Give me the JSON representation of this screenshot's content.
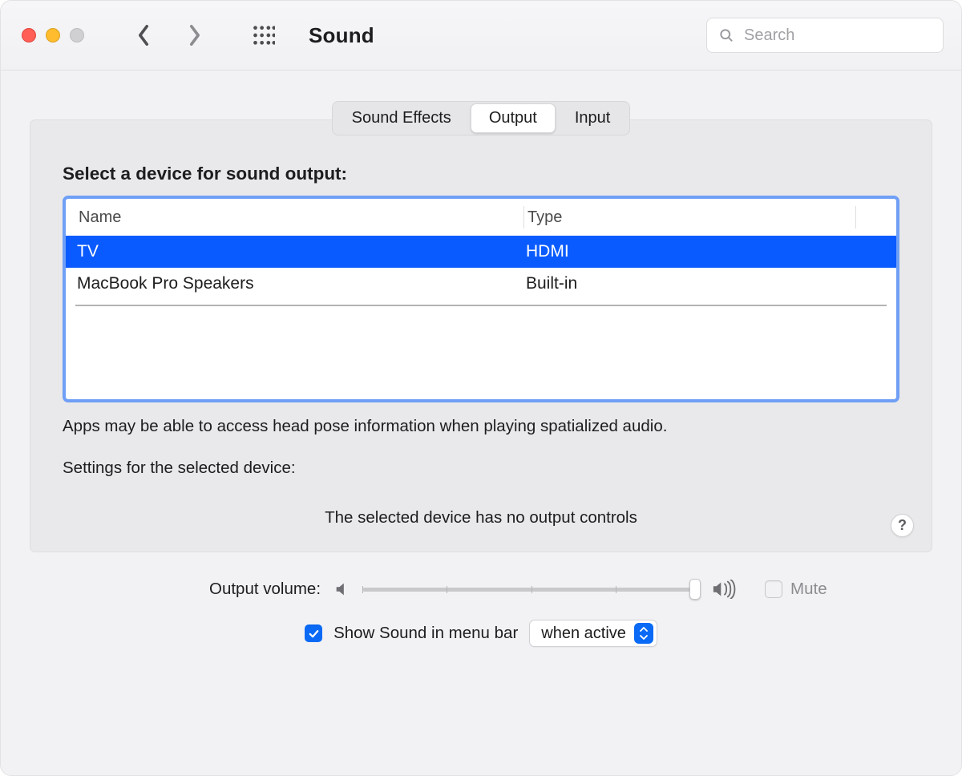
{
  "header": {
    "title": "Sound",
    "search_placeholder": "Search"
  },
  "tabs": [
    {
      "label": "Sound Effects",
      "selected": false
    },
    {
      "label": "Output",
      "selected": true
    },
    {
      "label": "Input",
      "selected": false
    }
  ],
  "main": {
    "section_label": "Select a device for sound output:",
    "columns": {
      "name": "Name",
      "type": "Type"
    },
    "devices": [
      {
        "name": "TV",
        "type": "HDMI",
        "selected": true
      },
      {
        "name": "MacBook Pro Speakers",
        "type": "Built-in",
        "selected": false
      }
    ],
    "spatial_note": "Apps may be able to access head pose information when playing spatialized audio.",
    "settings_label": "Settings for the selected device:",
    "no_controls": "The selected device has no output controls",
    "help_label": "?"
  },
  "footer": {
    "volume_label": "Output volume:",
    "volume_percent": 100,
    "mute_label": "Mute",
    "mute_checked": false,
    "mute_disabled": true,
    "menubar_checked": true,
    "menubar_label": "Show Sound in menu bar",
    "menubar_select": "when active"
  }
}
